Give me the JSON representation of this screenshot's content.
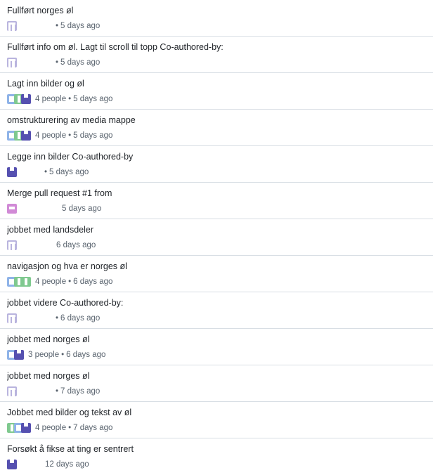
{
  "commits": [
    {
      "title": "Fullført norges øl",
      "avatars": [
        "pa"
      ],
      "people": "",
      "time": "5 days ago",
      "gap": 52
    },
    {
      "title": "Fullført info om øl. Lagt til scroll til topp Co-authored-by:",
      "avatars": [
        "pa"
      ],
      "people": "",
      "time": "5 days ago",
      "gap": 52
    },
    {
      "title": "Lagt inn bilder og øl",
      "avatars": [
        "pe",
        "pd",
        "pb"
      ],
      "people": "4 people",
      "time": "5 days ago",
      "gap": 0
    },
    {
      "title": "omstrukturering av media mappe",
      "avatars": [
        "pe",
        "pd",
        "pb"
      ],
      "people": "4 people",
      "time": "5 days ago",
      "gap": 0
    },
    {
      "title": "Legge inn bilder Co-authored-by",
      "avatars": [
        "pb"
      ],
      "people": "",
      "time": "5 days ago",
      "gap": 36
    },
    {
      "title": "Merge pull request #1 from",
      "avatars": [
        "pc"
      ],
      "people": "",
      "time": "5 days ago",
      "gap": 64,
      "noSep": true
    },
    {
      "title": "jobbet med landsdeler",
      "avatars": [
        "pa"
      ],
      "people": "",
      "time": "6 days ago",
      "gap": 56,
      "noSep": true
    },
    {
      "title": "navigasjon og hva er norges øl",
      "avatars": [
        "pe",
        "pd",
        "pd"
      ],
      "people": "4 people",
      "time": "6 days ago",
      "gap": 0
    },
    {
      "title": "jobbet videre Co-authored-by:",
      "avatars": [
        "pa"
      ],
      "people": "",
      "time": "6 days ago",
      "gap": 52
    },
    {
      "title": "jobbet med norges øl",
      "avatars": [
        "pe",
        "pb"
      ],
      "people": "3 people",
      "time": "6 days ago",
      "gap": 0
    },
    {
      "title": "jobbet med norges øl",
      "avatars": [
        "pa"
      ],
      "people": "",
      "time": "7 days ago",
      "gap": 52
    },
    {
      "title": "Jobbet med bilder og tekst av øl",
      "avatars": [
        "pd",
        "pe",
        "pb"
      ],
      "people": "4 people",
      "time": "7 days ago",
      "gap": 0
    },
    {
      "title": "Forsøkt å fikse at ting er sentrert",
      "avatars": [
        "pb"
      ],
      "people": "",
      "time": "12 days ago",
      "gap": 40,
      "noSep": true
    }
  ]
}
